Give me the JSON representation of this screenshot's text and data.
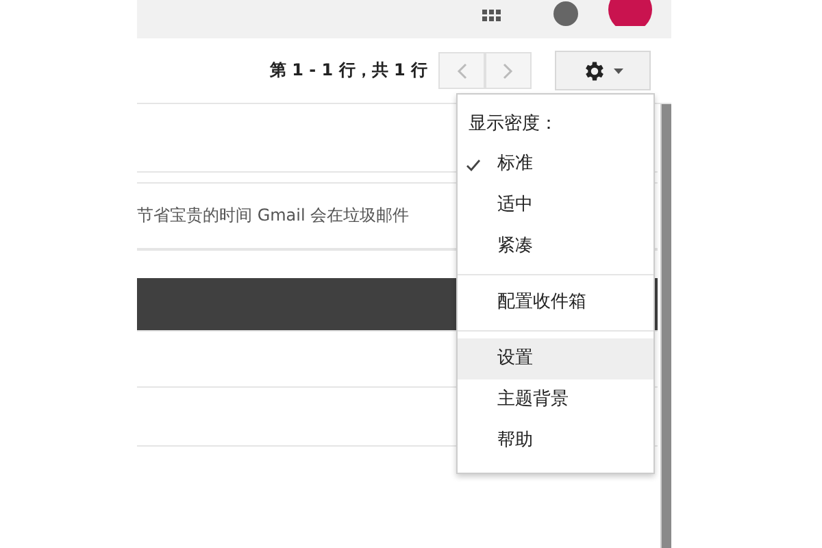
{
  "toolbar": {
    "pagination": "第 1 - 1 行，共 1 行",
    "prev_disabled": true,
    "next_disabled": true
  },
  "message_rows": [
    {
      "kind": "blank"
    },
    {
      "kind": "text",
      "text": "节省宝贵的时间 Gmail 会在垃圾邮件"
    },
    {
      "kind": "blank"
    },
    {
      "kind": "dark"
    },
    {
      "kind": "blank"
    },
    {
      "kind": "blank"
    }
  ],
  "settings_menu": {
    "items": [
      {
        "kind": "label",
        "text": "显示密度："
      },
      {
        "kind": "option",
        "text": "标准",
        "checked": true,
        "selected": false
      },
      {
        "kind": "option",
        "text": "适中",
        "checked": false,
        "selected": false
      },
      {
        "kind": "option",
        "text": "紧凑",
        "checked": false,
        "selected": false
      },
      {
        "kind": "divider"
      },
      {
        "kind": "action",
        "text": "配置收件箱",
        "selected": false
      },
      {
        "kind": "divider"
      },
      {
        "kind": "action",
        "text": "设置",
        "selected": true
      },
      {
        "kind": "action",
        "text": "主题背景",
        "selected": false
      },
      {
        "kind": "action",
        "text": "帮助",
        "selected": false
      }
    ]
  }
}
